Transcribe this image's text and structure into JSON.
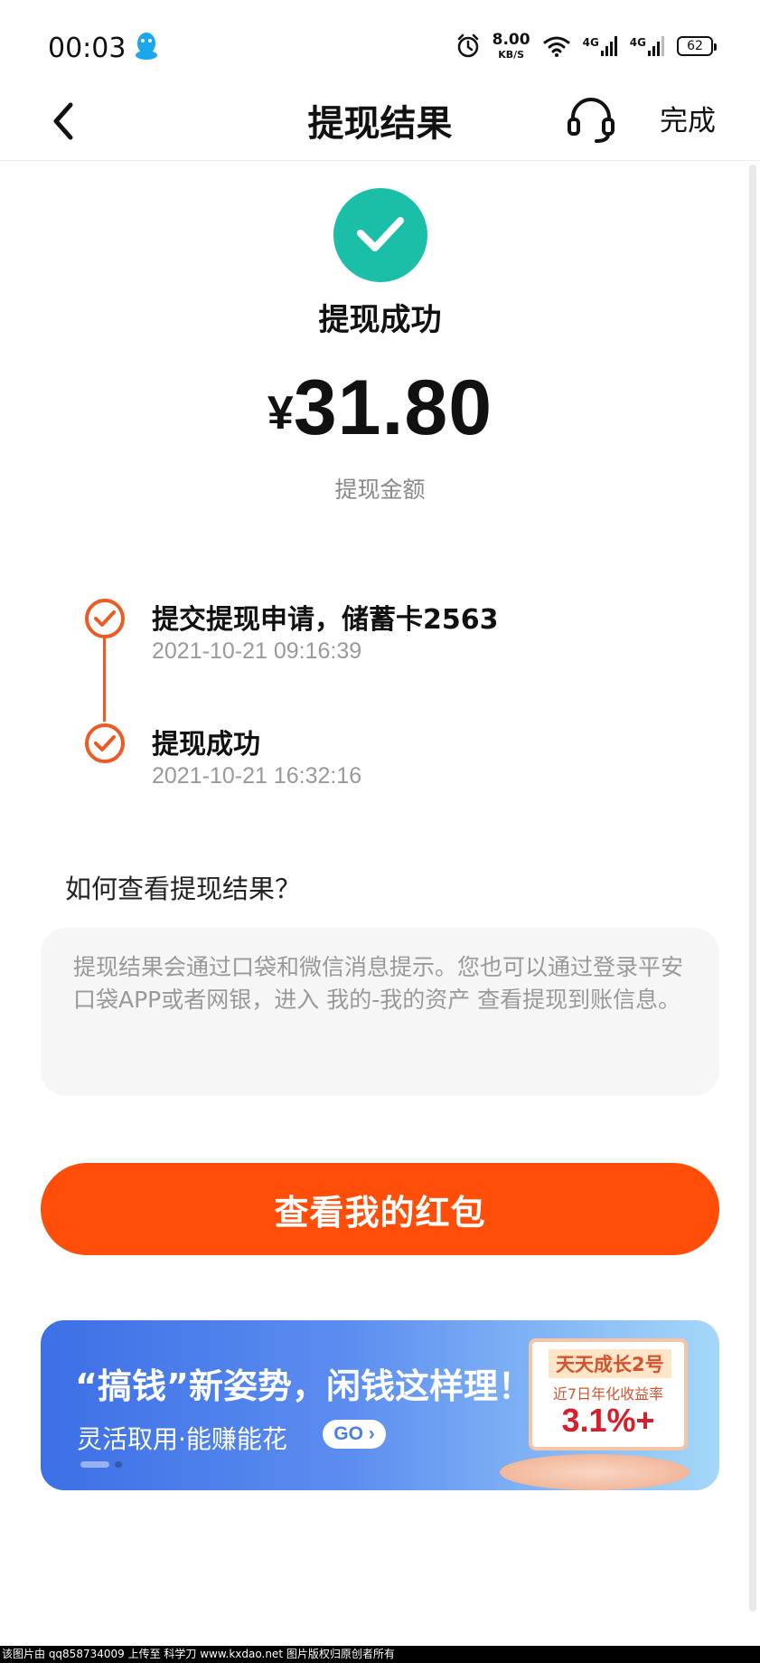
{
  "status_bar": {
    "time": "00:03",
    "speed_value": "8.00",
    "speed_unit": "KB/S",
    "network_1": "4G",
    "network_2": "4G",
    "battery": "62"
  },
  "nav": {
    "title": "提现结果",
    "done_label": "完成"
  },
  "result": {
    "status": "提现成功",
    "currency": "¥",
    "amount": "31.80",
    "amount_label": "提现金额"
  },
  "timeline": [
    {
      "title": "提交提现申请，储蓄卡2563",
      "time": "2021-10-21 09:16:39"
    },
    {
      "title": "提现成功",
      "time": "2021-10-21 16:32:16"
    }
  ],
  "help": {
    "title": "如何查看提现结果？",
    "text": "提现结果会通过口袋和微信消息提示。您也可以通过登录平安口袋APP或者网银，进入 我的-我的资产 查看提现到账信息。"
  },
  "main_button": {
    "label": "查看我的红包"
  },
  "banner": {
    "title": "“搞钱”新姿势，闲钱这样理！",
    "subtitle": "灵活取用·能赚能花",
    "go_label": "GO ›",
    "card_tag": "天天成长2号",
    "card_desc": "近7日年化收益率",
    "card_rate": "3.1%+"
  },
  "footer": {
    "text": "该图片由 qq858734009 上传至 科学刀 www.kxdao.net 图片版权归原创者所有"
  },
  "colors": {
    "success": "#1bbfa8",
    "timeline_accent": "#ee5a24",
    "primary_button": "#ff4e0a",
    "banner_start": "#3d6fe6",
    "banner_end": "#a5d8f8"
  }
}
